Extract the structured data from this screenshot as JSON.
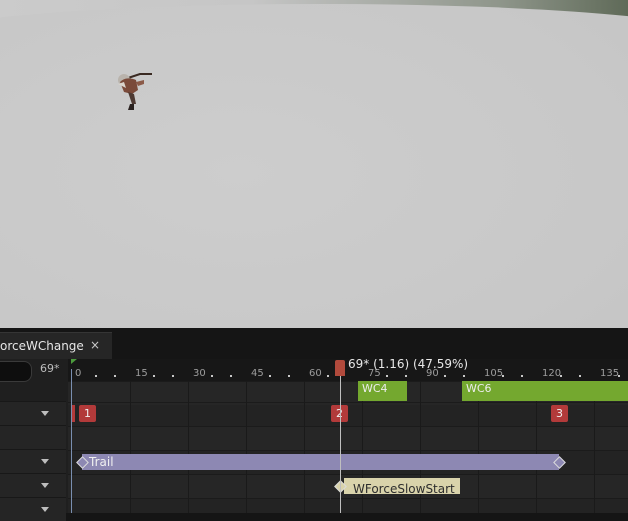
{
  "viewport": {
    "description_icon": "animated-character"
  },
  "tab": {
    "title": "orceWChange",
    "close": "×"
  },
  "left_panel": {
    "frame_readout": "69*"
  },
  "timeline": {
    "playhead_label": "69* (1.16) (47.59%)",
    "ticks": [
      "0",
      "15",
      "30",
      "45",
      "60",
      "75",
      "90",
      "105",
      "120",
      "135"
    ],
    "clips": [
      {
        "label": "WC4"
      },
      {
        "label": "WC6"
      }
    ],
    "markers": [
      "1",
      "2",
      "3"
    ],
    "notify_state": "Trail",
    "notify_event": "WForceSlowStart"
  },
  "colors": {
    "clip": "#74a82f",
    "marker": "#b23a3a",
    "notify_state": "#8d88b3",
    "notify_event": "#d9d3ab",
    "playhead": "#b14a3c"
  }
}
